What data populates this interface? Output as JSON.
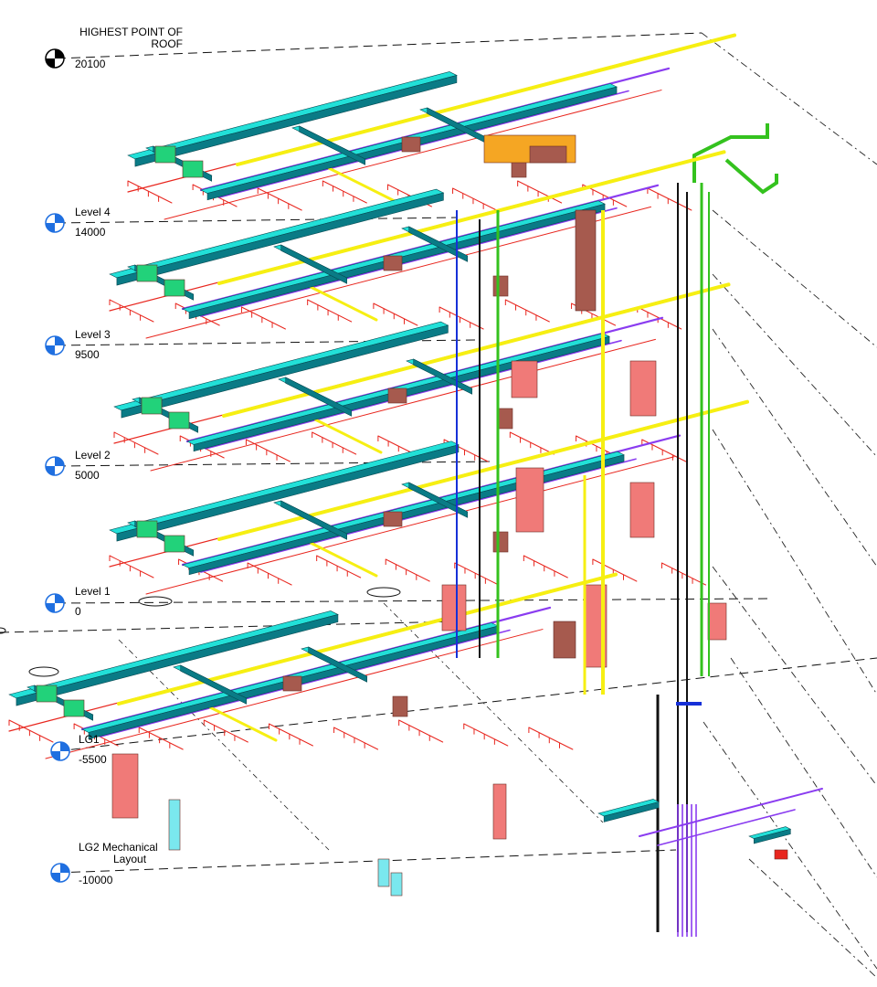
{
  "levels": [
    {
      "name_line1": "HIGHEST POINT OF",
      "name_line2": "ROOF",
      "elevation": "20100",
      "head_color": "#000000"
    },
    {
      "name_line1": "Level 4",
      "elevation": "14000",
      "head_color": "#1f6fe0"
    },
    {
      "name_line1": "Level 3",
      "elevation": "9500",
      "head_color": "#1f6fe0"
    },
    {
      "name_line1": "Level 2",
      "elevation": "5000",
      "head_color": "#1f6fe0"
    },
    {
      "name_line1": "Level 1",
      "elevation": "0",
      "head_color": "#1f6fe0"
    },
    {
      "name_line1": "LG1",
      "elevation": "-5500",
      "head_color": "#1f6fe0"
    },
    {
      "name_line1": "LG2 Mechanical",
      "name_line2": "Layout",
      "elevation": "-10000",
      "head_color": "#1f6fe0"
    }
  ],
  "colors": {
    "duct_supply": "#22e0d8",
    "duct_dark": "#0a7b86",
    "duct_green": "#22d27a",
    "pipe_red": "#e8261e",
    "pipe_yellow": "#f6ef12",
    "pipe_purple": "#8a3cf0",
    "pipe_blue": "#1630d8",
    "pipe_green": "#34c21e",
    "equip_salmon": "#f07a78",
    "equip_brown": "#a65a4e",
    "equip_orange": "#f5a623",
    "riser_black": "#111111"
  }
}
